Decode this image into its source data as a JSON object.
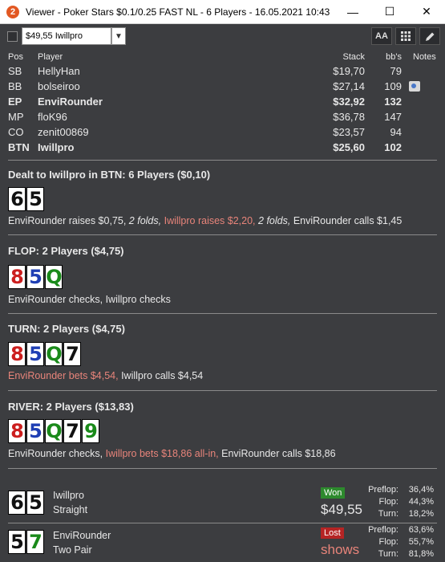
{
  "window": {
    "icon_label": "2",
    "title": "Viewer - Poker Stars $0.1/0.25 FAST NL - 6 Players - 16.05.2021 10:43",
    "controls": [
      "—",
      "☐",
      "✕"
    ]
  },
  "toolbar": {
    "hand_select_value": "$49,55 Iwillpro",
    "buttons": [
      "AA",
      "grid",
      "pencil"
    ]
  },
  "players": {
    "headers": {
      "pos": "Pos",
      "player": "Player",
      "stack": "Stack",
      "bbs": "bb's",
      "notes": "Notes"
    },
    "rows": [
      {
        "pos": "SB",
        "name": "HellyHan",
        "stack": "$19,70",
        "bbs": "79",
        "bold": false,
        "note": false
      },
      {
        "pos": "BB",
        "name": "bolseiroo",
        "stack": "$27,14",
        "bbs": "109",
        "bold": false,
        "note": true
      },
      {
        "pos": "EP",
        "name": "EnviRounder",
        "stack": "$32,92",
        "bbs": "132",
        "bold": true,
        "note": false
      },
      {
        "pos": "MP",
        "name": "floK96",
        "stack": "$36,78",
        "bbs": "147",
        "bold": false,
        "note": false
      },
      {
        "pos": "CO",
        "name": "zenit00869",
        "stack": "$23,57",
        "bbs": "94",
        "bold": false,
        "note": false
      },
      {
        "pos": "BTN",
        "name": "Iwillpro",
        "stack": "$25,60",
        "bbs": "102",
        "bold": true,
        "note": false
      }
    ]
  },
  "preflop": {
    "title": "Dealt to Iwillpro in BTN: 6 Players ($0,10)",
    "cards": [
      {
        "rank": "6",
        "suit": "black"
      },
      {
        "rank": "5",
        "suit": "black"
      }
    ],
    "actions": {
      "a1": "EnviRounder raises $0,75,",
      "a2": "2 folds,",
      "a3": "Iwillpro raises $2,20,",
      "a4": "2 folds,",
      "a5": "EnviRounder calls $1,45"
    }
  },
  "flop": {
    "title": "FLOP: 2 Players ($4,75)",
    "cards": [
      {
        "rank": "8",
        "suit": "red"
      },
      {
        "rank": "5",
        "suit": "blue"
      },
      {
        "rank": "Q",
        "suit": "green"
      }
    ],
    "actions": {
      "a1": "EnviRounder checks, Iwillpro checks"
    }
  },
  "turn": {
    "title": "TURN: 2 Players ($4,75)",
    "cards": [
      {
        "rank": "8",
        "suit": "red"
      },
      {
        "rank": "5",
        "suit": "blue"
      },
      {
        "rank": "Q",
        "suit": "green"
      },
      {
        "rank": "7",
        "suit": "black"
      }
    ],
    "actions": {
      "a1": "EnviRounder bets $4,54,",
      "a2": "Iwillpro calls $4,54"
    }
  },
  "river": {
    "title": "RIVER: 2 Players ($13,83)",
    "cards": [
      {
        "rank": "8",
        "suit": "red"
      },
      {
        "rank": "5",
        "suit": "blue"
      },
      {
        "rank": "Q",
        "suit": "green"
      },
      {
        "rank": "7",
        "suit": "black"
      },
      {
        "rank": "9",
        "suit": "green"
      }
    ],
    "actions": {
      "a1": "EnviRounder checks,",
      "a2": "Iwillpro bets $18,86 all-in,",
      "a3": "EnviRounder calls $18,86"
    }
  },
  "results": [
    {
      "cards": [
        {
          "rank": "6",
          "suit": "black"
        },
        {
          "rank": "5",
          "suit": "black"
        }
      ],
      "name": "Iwillpro",
      "hand": "Straight",
      "badge": "Won",
      "amount": "$49,55",
      "equity": {
        "preflop_label": "Preflop:",
        "preflop": "36,4%",
        "flop_label": "Flop:",
        "flop": "44,3%",
        "turn_label": "Turn:",
        "turn": "18,2%"
      }
    },
    {
      "cards": [
        {
          "rank": "5",
          "suit": "black"
        },
        {
          "rank": "7",
          "suit": "green"
        }
      ],
      "name": "EnviRounder",
      "hand": "Two Pair",
      "badge": "Lost",
      "amount": "shows",
      "equity": {
        "preflop_label": "Preflop:",
        "preflop": "63,6%",
        "flop_label": "Flop:",
        "flop": "55,7%",
        "turn_label": "Turn:",
        "turn": "81,8%"
      }
    }
  ]
}
